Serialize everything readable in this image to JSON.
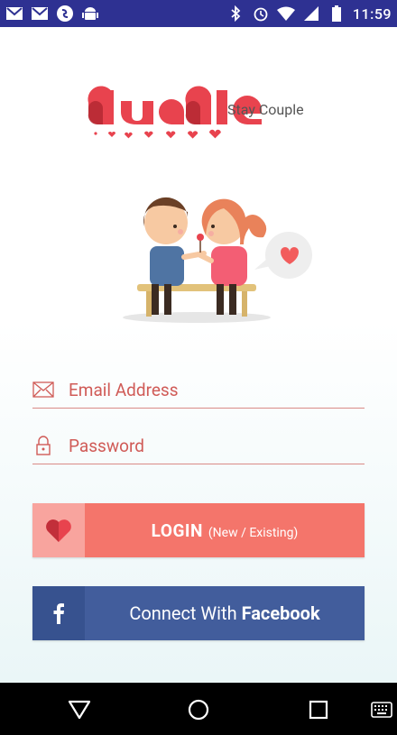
{
  "status_bar": {
    "time": "11:59",
    "left_icons": [
      "gmail-icon",
      "gmail-icon",
      "shazam-icon",
      "android-icon"
    ],
    "right_icons": [
      "bluetooth-icon",
      "alarm-icon",
      "wifi-icon",
      "cell-signal-icon",
      "battery-icon"
    ],
    "background": "#2e3192"
  },
  "brand": {
    "tagline": "Stay Couple",
    "logo_color": "#e8434e"
  },
  "form": {
    "email_placeholder": "Email Address",
    "password_placeholder": "Password"
  },
  "buttons": {
    "login_main": "LOGIN",
    "login_sub": "(New / Existing)",
    "facebook_prefix": "Connect With ",
    "facebook_bold": "Facebook"
  },
  "colors": {
    "login": "#f4756b",
    "facebook": "#425d9c",
    "accent": "#d05b57"
  }
}
